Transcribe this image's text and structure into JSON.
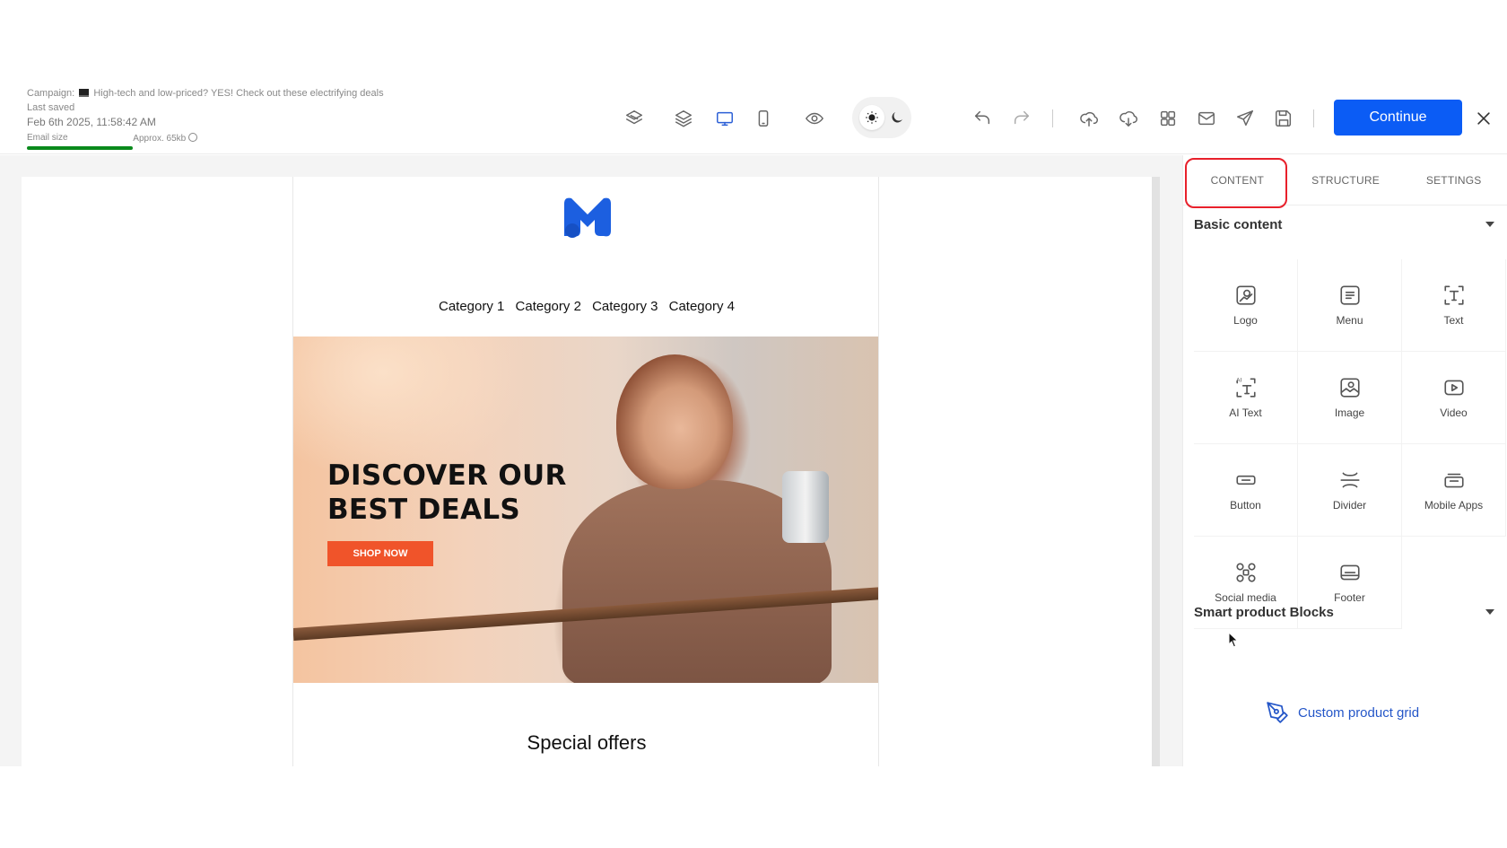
{
  "header": {
    "campaign_label": "Campaign:",
    "campaign_icon": "laptop-emoji",
    "campaign_name": "High-tech and low-priced? YES! Check out these electrifying deals",
    "last_saved_label": "Last saved",
    "last_saved_date": "Feb 6th 2025, 11:58:42 AM",
    "email_size_label": "Email size",
    "email_size_value": "Approx. 65kb",
    "email_size_color": "#0a8a1c"
  },
  "toolbar": {
    "continue_label": "Continue",
    "accent_color": "#0b5cf5",
    "icons": [
      "layers-stack-icon",
      "layers-icon",
      "desktop-icon",
      "mobile-icon",
      "preview-eye-icon",
      "sun-icon",
      "moon-icon",
      "undo-icon",
      "redo-icon",
      "upload-icon",
      "download-icon",
      "grid-icon",
      "mail-icon",
      "send-icon",
      "save-icon",
      "close-icon"
    ]
  },
  "email": {
    "logo_color": "#1c5fe0",
    "nav": [
      "Category 1",
      "Category 2",
      "Category 3",
      "Category 4"
    ],
    "hero_title_line1": "DISCOVER OUR",
    "hero_title_line2": "BEST DEALS",
    "hero_button": "SHOP NOW",
    "hero_button_color": "#f0542a",
    "section_title": "Special offers"
  },
  "panel": {
    "tabs": [
      {
        "label": "CONTENT",
        "active": true
      },
      {
        "label": "STRUCTURE",
        "active": false
      },
      {
        "label": "SETTINGS",
        "active": false
      }
    ],
    "highlight_color": "#e8202b",
    "basic_content_title": "Basic content",
    "blocks": [
      {
        "label": "Logo",
        "icon": "logo-icon"
      },
      {
        "label": "Menu",
        "icon": "menu-icon"
      },
      {
        "label": "Text",
        "icon": "text-icon"
      },
      {
        "label": "AI Text",
        "icon": "ai-text-icon"
      },
      {
        "label": "Image",
        "icon": "image-icon"
      },
      {
        "label": "Video",
        "icon": "video-icon"
      },
      {
        "label": "Button",
        "icon": "button-icon"
      },
      {
        "label": "Divider",
        "icon": "divider-icon"
      },
      {
        "label": "Mobile Apps",
        "icon": "mobile-apps-icon"
      },
      {
        "label": "Social media",
        "icon": "social-media-icon"
      },
      {
        "label": "Footer",
        "icon": "footer-icon"
      }
    ],
    "smart_blocks_title": "Smart product Blocks",
    "custom_product_grid": "Custom product grid",
    "link_color": "#2456c8"
  }
}
